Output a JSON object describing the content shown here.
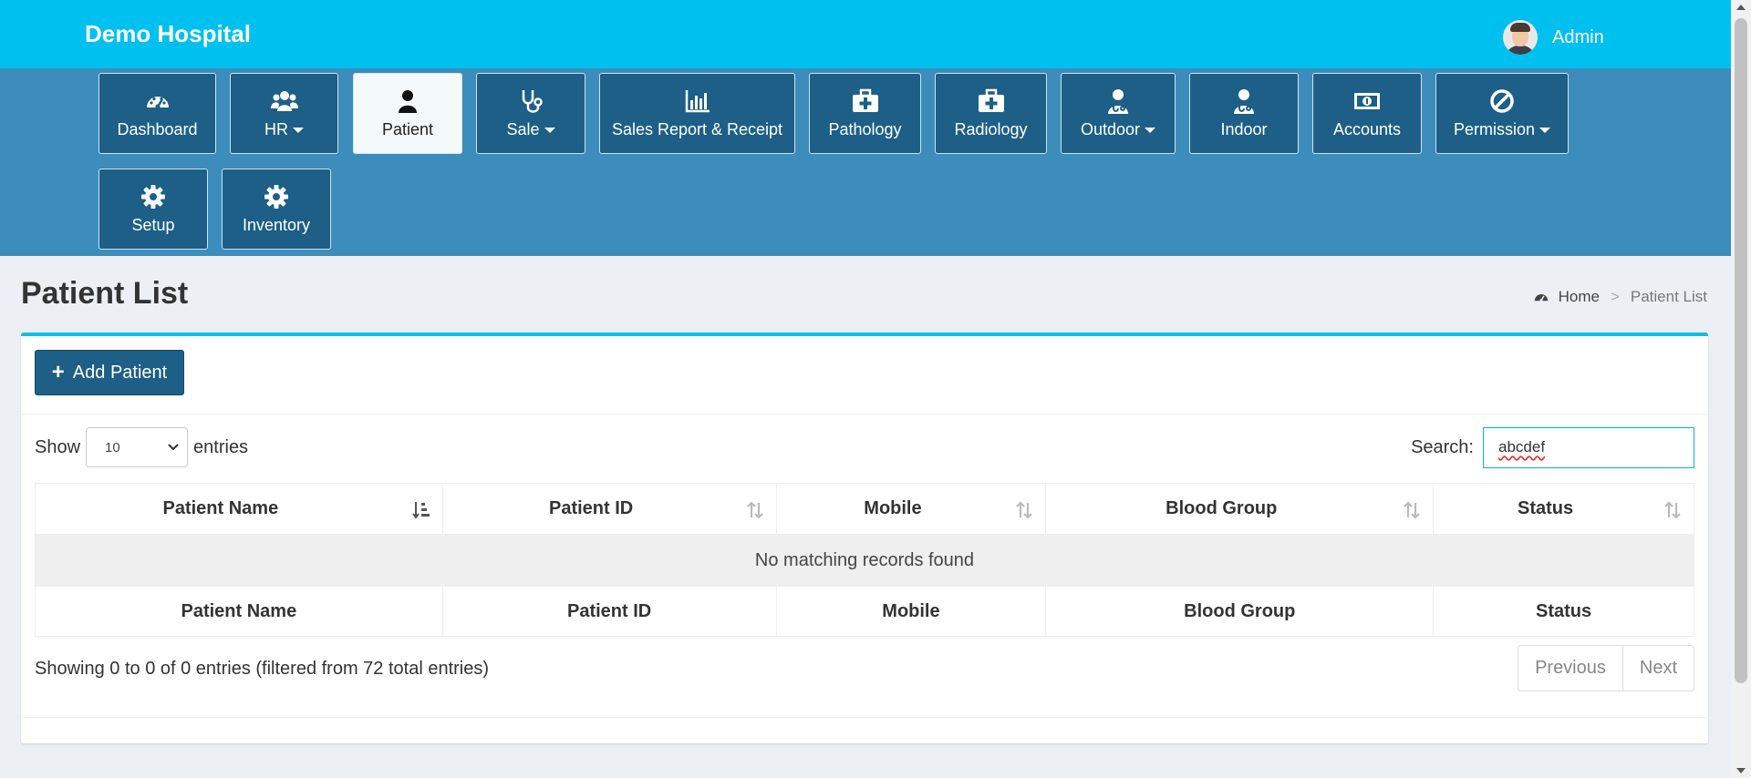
{
  "app": {
    "brand": "Demo Hospital",
    "accent_color": "#00c0ef",
    "nav_color": "#3c8dbc",
    "tile_color": "#1d5f86"
  },
  "user": {
    "name": "Admin",
    "avatar_icon": "user-avatar-icon"
  },
  "nav": {
    "items": [
      {
        "label": "Dashboard",
        "icon": "dashboard-gauge-icon",
        "dropdown": false,
        "active": false
      },
      {
        "label": "HR",
        "icon": "users-icon",
        "dropdown": true,
        "active": false
      },
      {
        "label": "Patient",
        "icon": "user-icon",
        "dropdown": false,
        "active": true
      },
      {
        "label": "Sale",
        "icon": "stethoscope-icon",
        "dropdown": true,
        "active": false
      },
      {
        "label": "Sales Report & Receipt",
        "icon": "bar-chart-icon",
        "dropdown": false,
        "active": false
      },
      {
        "label": "Pathology",
        "icon": "medkit-icon",
        "dropdown": false,
        "active": false
      },
      {
        "label": "Radiology",
        "icon": "medkit-icon",
        "dropdown": false,
        "active": false
      },
      {
        "label": "Outdoor",
        "icon": "doctor-icon",
        "dropdown": true,
        "active": false
      },
      {
        "label": "Indoor",
        "icon": "doctor-icon",
        "dropdown": false,
        "active": false
      },
      {
        "label": "Accounts",
        "icon": "money-icon",
        "dropdown": false,
        "active": false
      },
      {
        "label": "Permission",
        "icon": "ban-icon",
        "dropdown": true,
        "active": false
      },
      {
        "label": "Setup",
        "icon": "gear-icon",
        "dropdown": false,
        "active": false
      },
      {
        "label": "Inventory",
        "icon": "gear-icon",
        "dropdown": false,
        "active": false
      }
    ]
  },
  "page": {
    "title": "Patient List"
  },
  "breadcrumb": {
    "home": "Home",
    "separator": ">",
    "current": "Patient List"
  },
  "toolbar": {
    "add_label": "Add Patient"
  },
  "table_controls": {
    "show_label": "Show",
    "entries_value": "10",
    "entries_label": "entries",
    "search_label": "Search:",
    "search_value": "abcdef"
  },
  "table": {
    "columns": [
      "Patient Name",
      "Patient ID",
      "Mobile",
      "Blood Group",
      "Status"
    ],
    "sorted_column": "Patient Name",
    "empty_message": "No matching records found",
    "rows": []
  },
  "footer": {
    "info": "Showing 0 to 0 of 0 entries (filtered from 72 total entries)",
    "previous": "Previous",
    "next": "Next"
  }
}
